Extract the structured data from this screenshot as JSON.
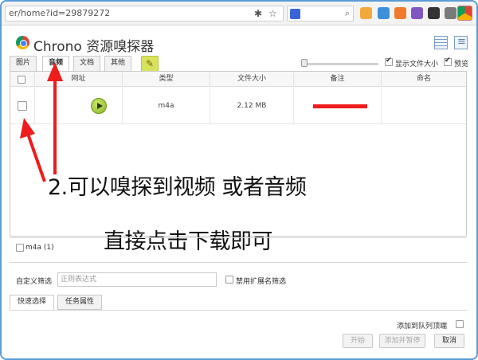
{
  "browser": {
    "url": "er/home?id=29879272",
    "accent_color": "#5b9bd5"
  },
  "app": {
    "title": "Chrono 资源嗅探器",
    "tabs": [
      "图片",
      "音频",
      "文档",
      "其他"
    ],
    "active_tab": "音频",
    "show_file_size_label": "显示文件大小",
    "show_file_size_checked": true,
    "preview_label": "预览",
    "preview_checked": true
  },
  "table": {
    "headers": [
      "网址",
      "类型",
      "文件大小",
      "备注",
      "命名"
    ],
    "rows": [
      {
        "type": "m4a",
        "size": "2.12 MB"
      }
    ]
  },
  "overlay": {
    "line1": "2.可以嗅探到视频 或者音频",
    "line2": "直接点击下载即可",
    "annotation_color": "#ee1c1c"
  },
  "filters": {
    "type_filter_label": "m4a (1)",
    "custom_filter_label": "自定义筛选",
    "custom_filter_placeholder": "正则表达式",
    "disable_ext_label": "禁用扩展名筛选"
  },
  "bottom_tabs": [
    "快速选择",
    "任务属性"
  ],
  "actions": {
    "add_to_top_label": "添加到队列顶端",
    "start": "开始",
    "add_pause": "添加并暂停",
    "cancel": "取消"
  }
}
